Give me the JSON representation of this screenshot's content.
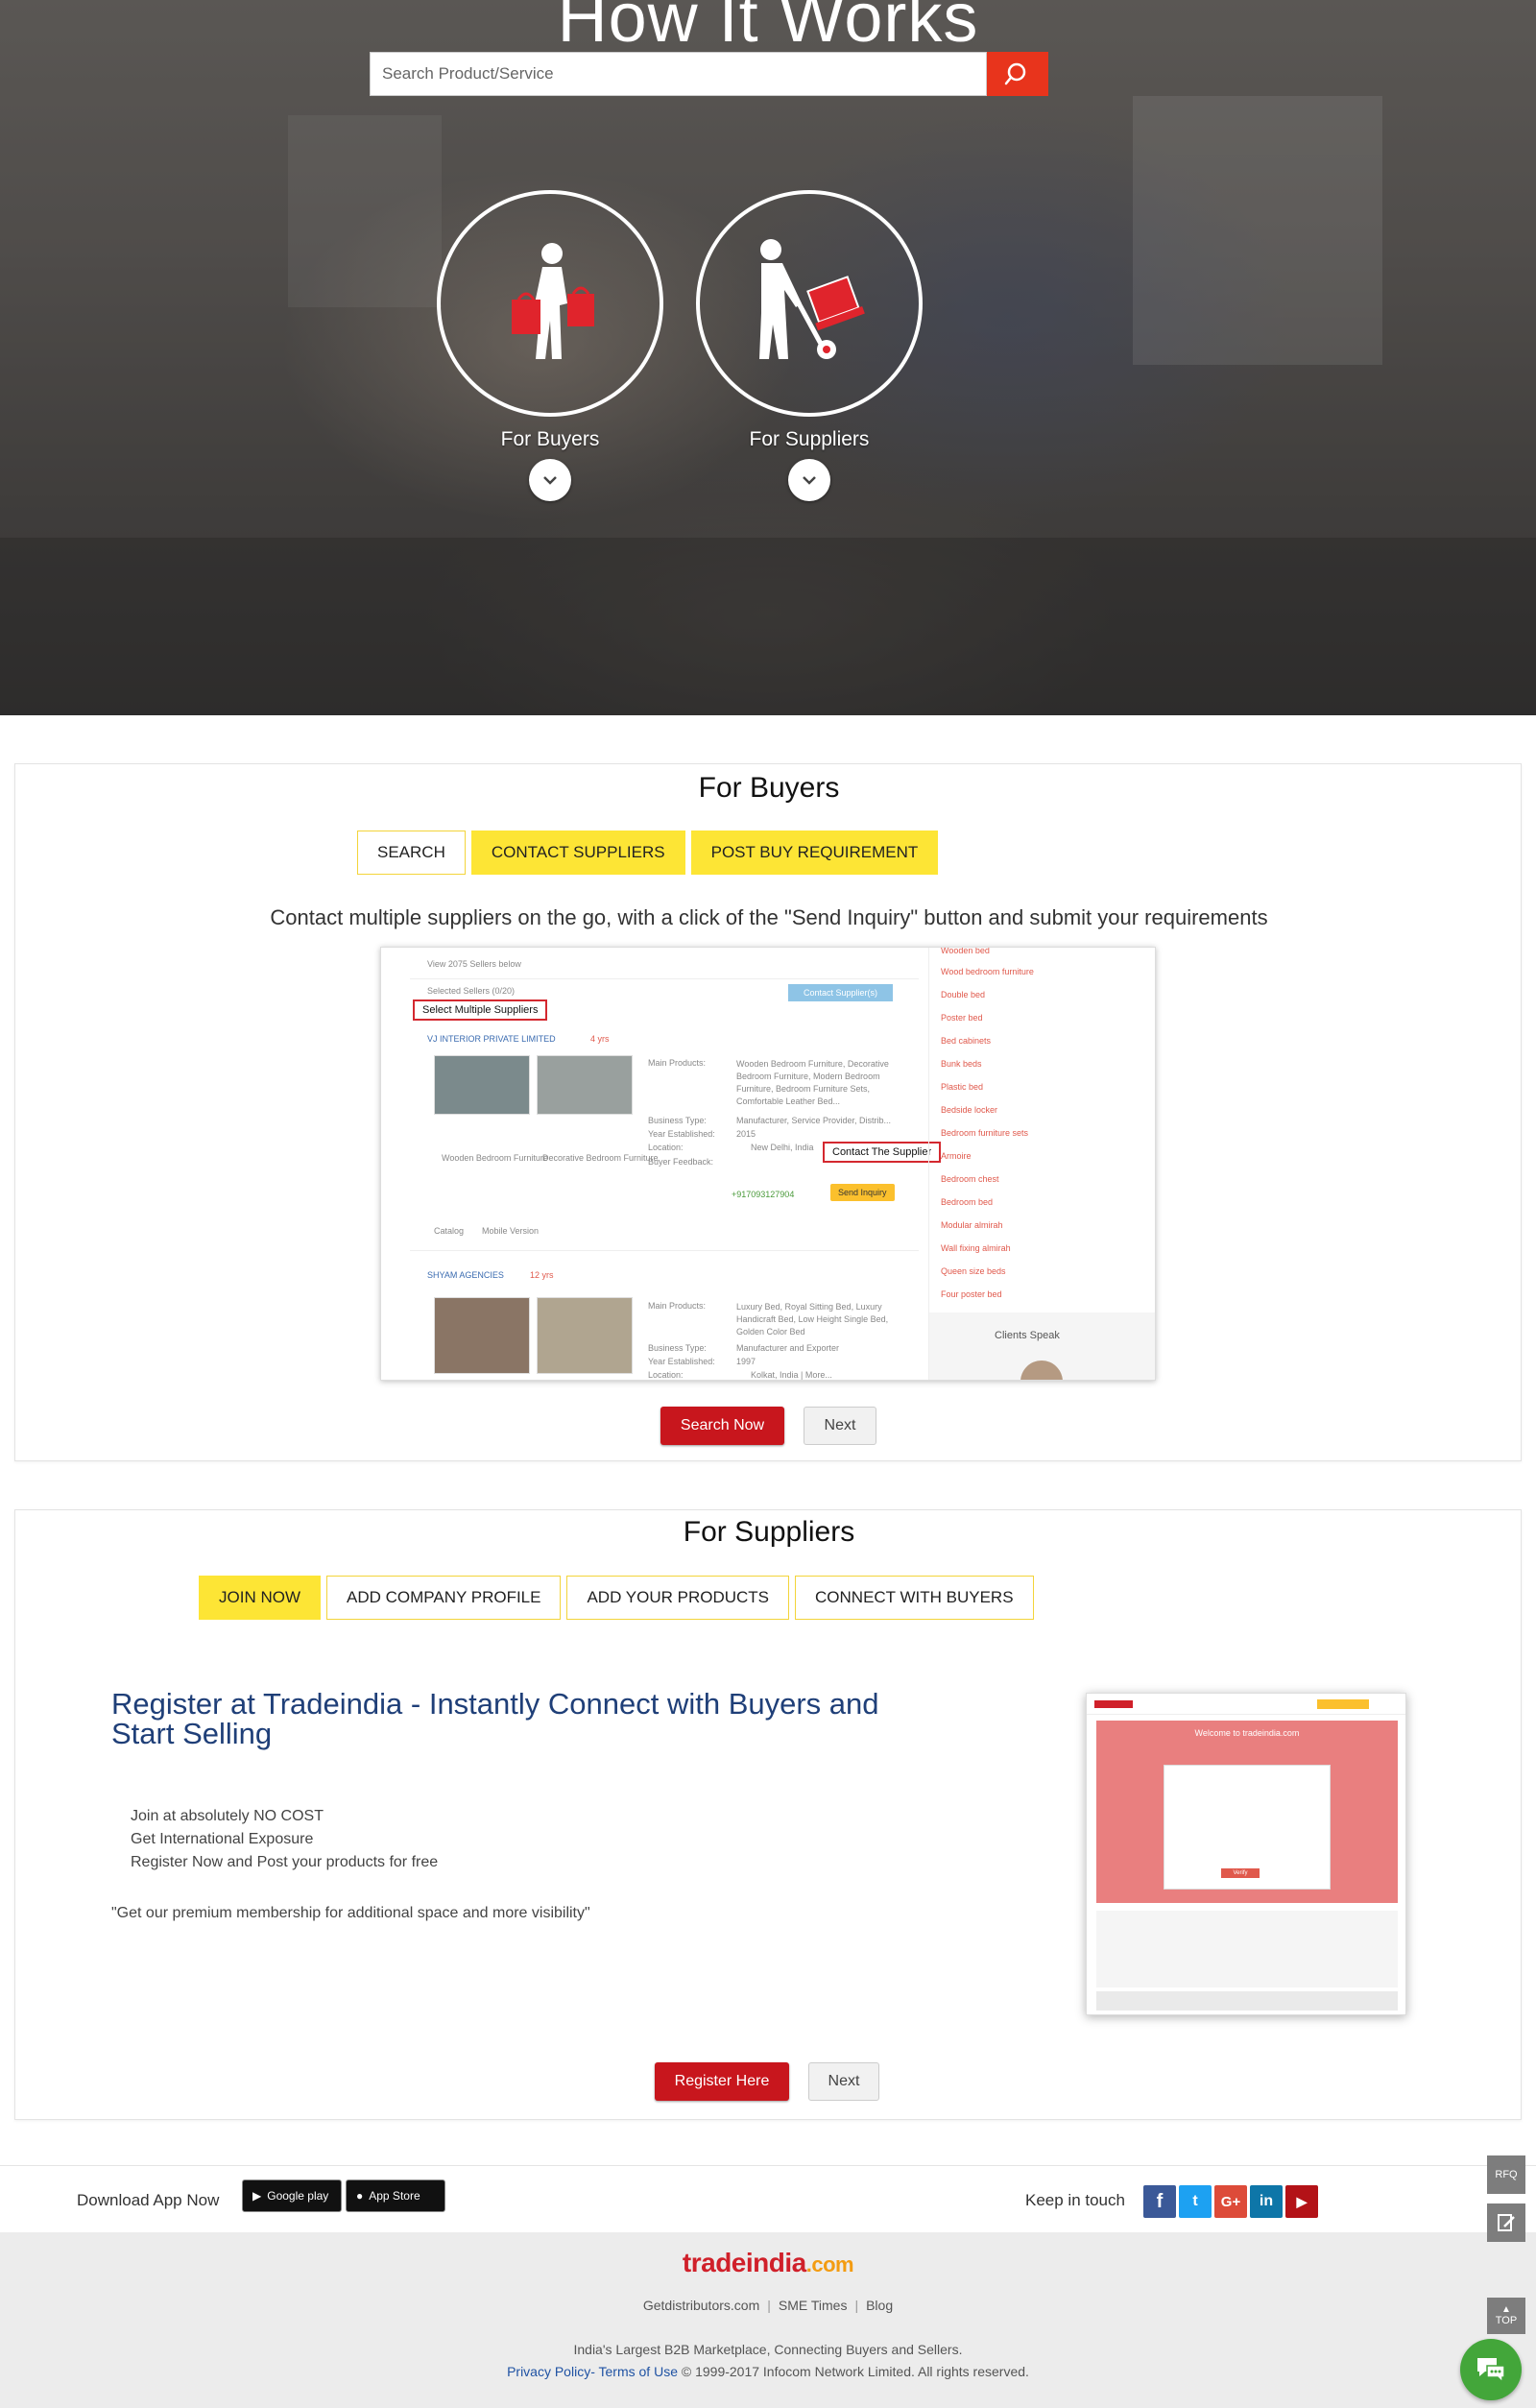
{
  "hero": {
    "title": "How It Works",
    "search_placeholder": "Search Product/Service",
    "roles": [
      {
        "label": "For Buyers",
        "icon": "buyer-with-bags-icon"
      },
      {
        "label": "For Suppliers",
        "icon": "supplier-with-trolley-icon"
      }
    ]
  },
  "buyers": {
    "title": "For Buyers",
    "tabs": [
      "SEARCH",
      "CONTACT SUPPLIERS",
      "POST BUY REQUIREMENT"
    ],
    "active_tab": "CONTACT SUPPLIERS",
    "description": "Contact multiple suppliers on the go, with a click of the \"Send Inquiry\" button and submit your requirements",
    "mock": {
      "view_sellers": "View 2075 Sellers below",
      "selected": "Selected Sellers (0/20)",
      "contact_button": "Contact Supplier(s)",
      "callout_select": "Select Multiple Suppliers",
      "callout_contact": "Contact The Supplier",
      "seller1": "VJ INTERIOR PRIVATE LIMITED",
      "seller1_years": "4 yrs",
      "seller1_products": [
        "Wooden Bedroom Furniture",
        "Decorative Bedroom Furniture"
      ],
      "main_products_label": "Main Products:",
      "main_products1": "Wooden Bedroom Furniture, Decorative Bedroom Furniture, Modern Bedroom Furniture, Bedroom Furniture Sets, Comfortable Leather Bed...",
      "business_type_label": "Business Type:",
      "business_type1": "Manufacturer, Service Provider, Distrib...",
      "year_label": "Year Established:",
      "year1": "2015",
      "location_label": "Location:",
      "location1": "New Delhi, India",
      "feedback_label": "Buyer Feedback:",
      "phone": "+917093127904",
      "send_inquiry": "Send Inquiry",
      "catalog": "Catalog",
      "mobile": "Mobile Version",
      "seller2": "SHYAM AGENCIES",
      "seller2_years": "12 yrs",
      "main_products2": "Luxury Bed, Royal Sitting Bed, Luxury Handicraft Bed, Low Height Single Bed, Golden Color Bed",
      "business_type2": "Manufacturer and Exporter",
      "year2": "1997",
      "location2": "Kolkat, India | More...",
      "sidebar_items": [
        "Wooden bed",
        "Wood bedroom furniture",
        "Double bed",
        "Poster bed",
        "Bed cabinets",
        "Bunk beds",
        "Plastic bed",
        "Bedside locker",
        "Bedroom furniture sets",
        "Armoire",
        "Bedroom chest",
        "Bedroom bed",
        "Modular almirah",
        "Wall fixing almirah",
        "Queen size beds",
        "Four poster bed"
      ],
      "clients_speak": "Clients Speak"
    },
    "primary_button": "Search Now",
    "next_button": "Next"
  },
  "suppliers": {
    "title": "For Suppliers",
    "tabs": [
      "JOIN NOW",
      "ADD COMPANY PROFILE",
      "ADD YOUR PRODUCTS",
      "CONNECT WITH BUYERS"
    ],
    "active_tab": "JOIN NOW",
    "heading": "Register at Tradeindia - Instantly Connect with Buyers and Start Selling",
    "bullets": [
      "Join at absolutely NO COST",
      "Get International Exposure",
      "Register Now and Post your products for free"
    ],
    "quote": "\"Get our premium membership for additional space and more visibility\"",
    "mock": {
      "welcome": "Welcome to tradeindia.com",
      "submit": "Verify"
    },
    "primary_button": "Register Here",
    "next_button": "Next"
  },
  "app_bar": {
    "download_label": "Download App Now",
    "google_play": "Google play",
    "app_store": "App Store",
    "keep_in_touch": "Keep in touch",
    "social": [
      {
        "name": "facebook-icon",
        "glyph": "f",
        "color": "#3b5998"
      },
      {
        "name": "twitter-icon",
        "glyph": "t",
        "color": "#1da1f2"
      },
      {
        "name": "google-plus-icon",
        "glyph": "G+",
        "color": "#dd4b39"
      },
      {
        "name": "linkedin-icon",
        "glyph": "in",
        "color": "#0e76a8"
      },
      {
        "name": "youtube-icon",
        "glyph": "▶",
        "color": "#b31217"
      }
    ]
  },
  "footer": {
    "logo_main": "tradeindia",
    "logo_suffix": ".com",
    "links": [
      "Getdistributors.com",
      "SME Times",
      "Blog"
    ],
    "tagline": "India's Largest B2B Marketplace, Connecting Buyers and Sellers.",
    "privacy": "Privacy Policy",
    "terms": "Terms of Use",
    "copyright": "© 1999-2017 Infocom Network Limited. All rights reserved."
  },
  "floating": {
    "rfq": "RFQ",
    "top": "TOP"
  },
  "colors": {
    "accent_red": "#e8341c",
    "button_red": "#c8161d",
    "tab_yellow": "#fde535",
    "heading_blue": "#1f3f78"
  }
}
